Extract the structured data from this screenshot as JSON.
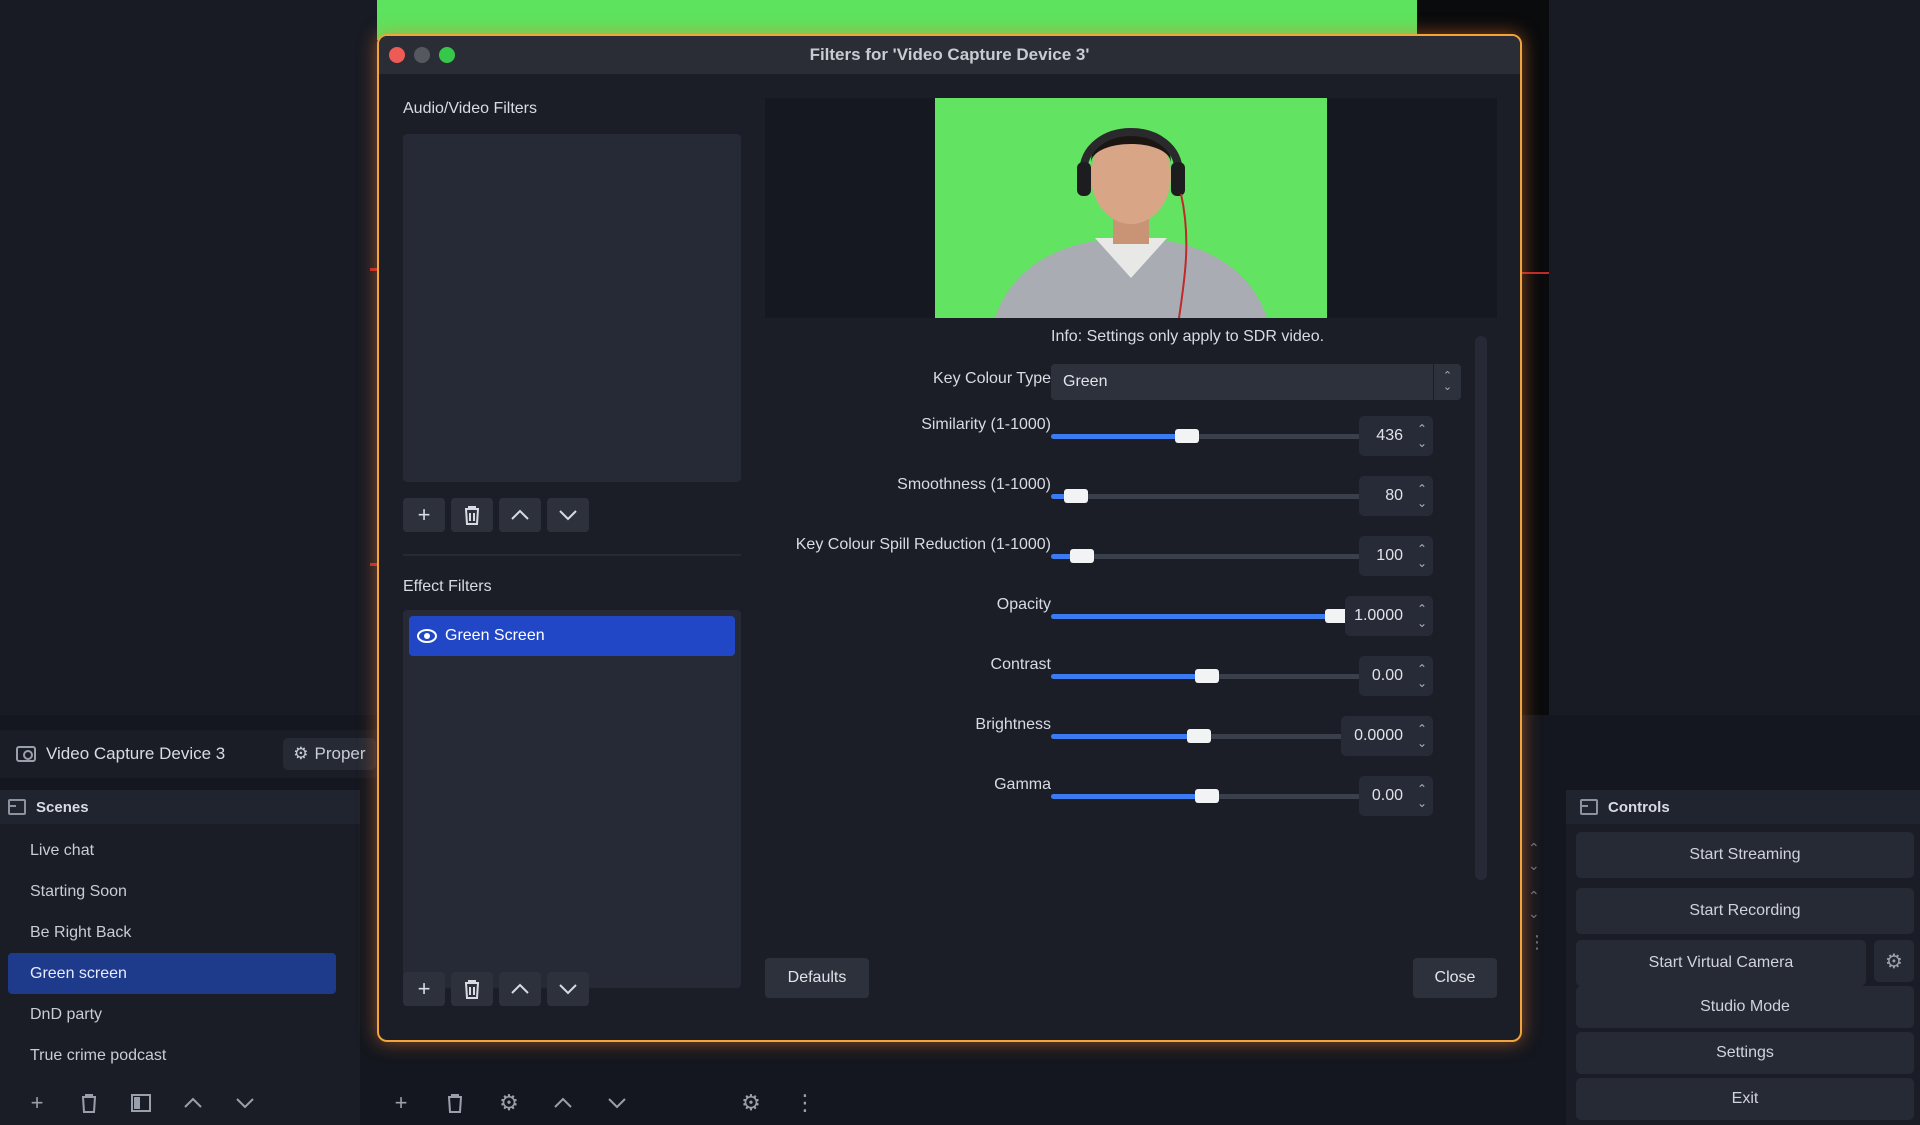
{
  "dialog": {
    "title": "Filters for 'Video Capture Device 3'",
    "av_label": "Audio/Video Filters",
    "effect_label": "Effect Filters",
    "effect_items": [
      {
        "label": "Green Screen",
        "selected": true
      }
    ],
    "info": "Info: Settings only apply to SDR video.",
    "key_colour_type": {
      "label": "Key Colour Type",
      "value": "Green"
    },
    "rows": [
      {
        "label": "Similarity (1-1000)",
        "value": "436",
        "fraction": 0.436
      },
      {
        "label": "Smoothness (1-1000)",
        "value": "80",
        "fraction": 0.08
      },
      {
        "label": "Key Colour Spill Reduction (1-1000)",
        "value": "100",
        "fraction": 0.1
      },
      {
        "label": "Opacity",
        "value": "1.0000",
        "fraction": 1.0
      },
      {
        "label": "Contrast",
        "value": "0.00",
        "fraction": 0.5
      },
      {
        "label": "Brightness",
        "value": "0.0000",
        "fraction": 0.5
      },
      {
        "label": "Gamma",
        "value": "0.00",
        "fraction": 0.5
      }
    ],
    "defaults_label": "Defaults",
    "close_label": "Close"
  },
  "source": {
    "name": "Video Capture Device 3",
    "properties_label": "Proper"
  },
  "scenes": {
    "title": "Scenes",
    "items": [
      {
        "label": "Live chat",
        "selected": false
      },
      {
        "label": "Starting Soon",
        "selected": false
      },
      {
        "label": "Be Right Back",
        "selected": false
      },
      {
        "label": "Green screen",
        "selected": true
      },
      {
        "label": "DnD party",
        "selected": false
      },
      {
        "label": "True crime podcast",
        "selected": false
      }
    ]
  },
  "controls": {
    "title": "Controls",
    "start_streaming": "Start Streaming",
    "start_recording": "Start Recording",
    "start_virtual_camera": "Start Virtual Camera",
    "studio_mode": "Studio Mode",
    "settings": "Settings",
    "exit": "Exit"
  },
  "colors": {
    "accent": "#2247c6",
    "slider": "#3b7bf2",
    "green_screen": "#62e361",
    "dialog_border": "#f0a43b"
  }
}
